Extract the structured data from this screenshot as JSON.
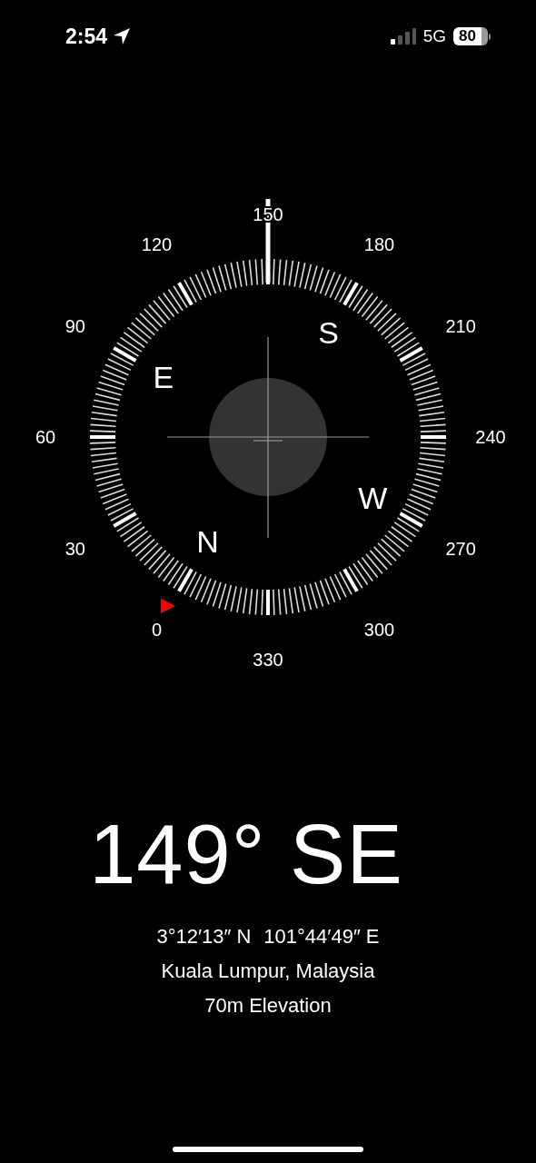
{
  "status_bar": {
    "time": "2:54",
    "network": "5G",
    "battery": "80"
  },
  "compass": {
    "degree_labels": [
      "0",
      "30",
      "60",
      "90",
      "120",
      "150",
      "180",
      "210",
      "240",
      "270",
      "300",
      "330"
    ],
    "cardinal_labels": [
      "N",
      "E",
      "S",
      "W"
    ]
  },
  "heading": "149° SE",
  "location": {
    "latitude": "3°12′13″ N",
    "longitude": "101°44′49″ E",
    "place": "Kuala Lumpur, Malaysia",
    "elevation": "70m Elevation"
  }
}
